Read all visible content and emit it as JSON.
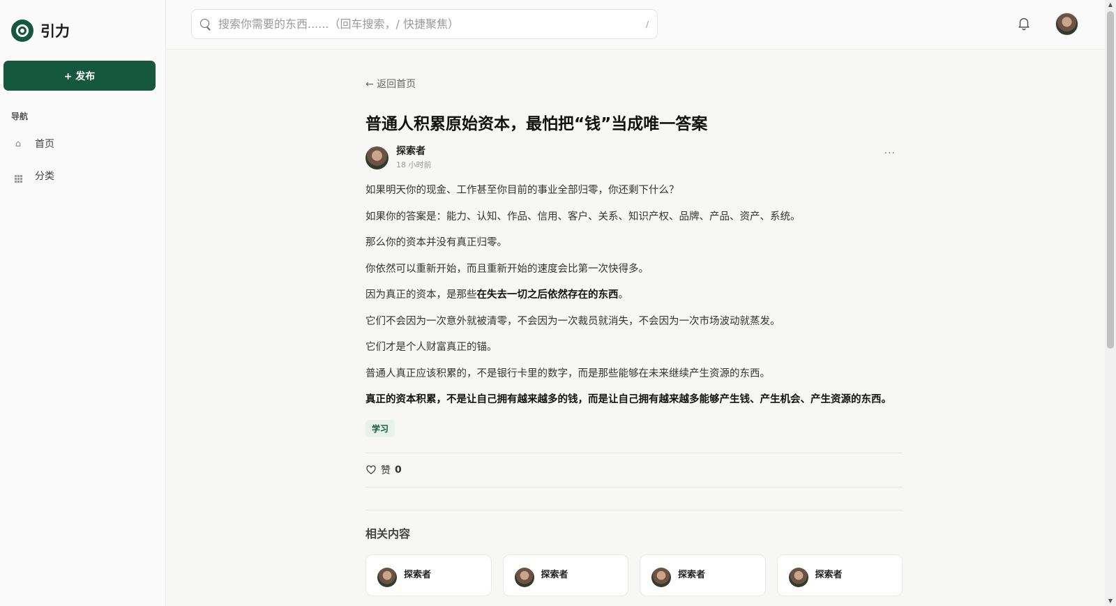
{
  "brand": {
    "name": "引力",
    "accent": "#15573f"
  },
  "sidebar": {
    "publish_label": "+ 发布",
    "nav_title": "导航",
    "items": [
      {
        "icon": "home-icon",
        "label": "首页"
      },
      {
        "icon": "grid-icon",
        "label": "分类"
      }
    ]
  },
  "search": {
    "placeholder": "搜索你需要的东西......（回车搜索，/ 快捷聚焦）",
    "shortcut": "/"
  },
  "header": {
    "bell_icon": "bell-icon",
    "avatar_icon": "user-avatar"
  },
  "post": {
    "back_label": "← 返回首页",
    "title": "普通人积累原始资本，最怕把“钱”当成唯一答案",
    "author": "探索者",
    "time": "18 小时前",
    "more_label": "···",
    "paragraphs": [
      "如果明天你的现金、工作甚至你目前的事业全部归零，你还剩下什么？",
      "如果你的答案是：能力、认知、作品、信用、客户、关系、知识产权、品牌、产品、资产、系统。",
      "那么你的资本并没有真正归零。",
      "你依然可以重新开始，而且重新开始的速度会比第一次快得多。",
      "它们不会因为一次意外就被清零，不会因为一次裁员就消失，不会因为一次市场波动就蒸发。",
      "它们才是个人财富真正的锚。",
      "普通人真正应该积累的，不是银行卡里的数字，而是那些能够在未来继续产生资源的东西。"
    ],
    "p5_prefix": "因为真正的资本，是那些",
    "p5_bold": "在失去一切之后依然存在的东西",
    "p5_suffix": "。",
    "closing_bold": "真正的资本积累，不是让自己拥有越来越多的钱，而是让自己拥有越来越多能够产生钱、产生机会、产生资源的东西。",
    "tag": "学习",
    "like_label": "赞",
    "like_count": "0"
  },
  "related": {
    "title": "相关内容",
    "cards": [
      {
        "author": "探索者"
      },
      {
        "author": "探索者"
      },
      {
        "author": "探索者"
      },
      {
        "author": "探索者"
      }
    ]
  }
}
